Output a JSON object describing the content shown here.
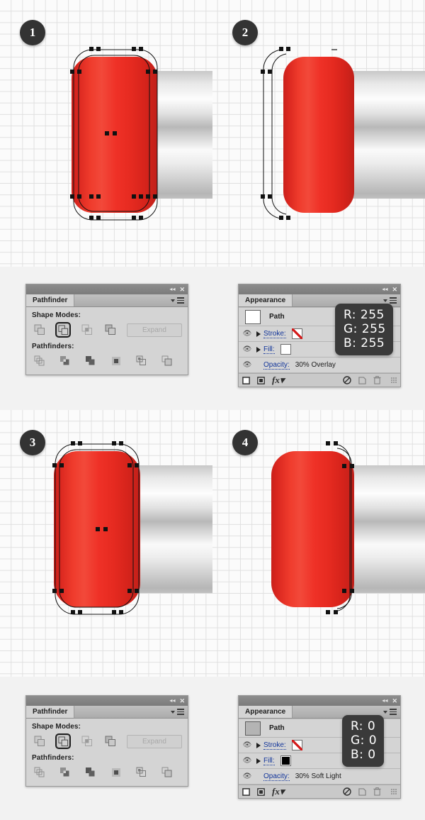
{
  "steps": [
    {
      "number": "1"
    },
    {
      "number": "2"
    },
    {
      "number": "3"
    },
    {
      "number": "4"
    }
  ],
  "pathfinder_panels": [
    {
      "tab_label": "Pathfinder",
      "shape_modes_label": "Shape Modes:",
      "pathfinders_label": "Pathfinders:",
      "expand_label": "Expand",
      "shape_mode_icons": [
        "unite-icon",
        "minus-front-icon",
        "intersect-icon",
        "exclude-icon"
      ],
      "selected_shape_mode_index": 1,
      "pathfinder_icons": [
        "divide-icon",
        "trim-icon",
        "merge-icon",
        "crop-icon",
        "outline-icon",
        "minus-back-icon"
      ],
      "titlebar_icons": [
        "collapse-icon",
        "close-icon"
      ],
      "menu_icon": "panel-menu-icon"
    },
    {
      "tab_label": "Pathfinder",
      "shape_modes_label": "Shape Modes:",
      "pathfinders_label": "Pathfinders:",
      "expand_label": "Expand",
      "shape_mode_icons": [
        "unite-icon",
        "minus-front-icon",
        "intersect-icon",
        "exclude-icon"
      ],
      "selected_shape_mode_index": 1,
      "pathfinder_icons": [
        "divide-icon",
        "trim-icon",
        "merge-icon",
        "crop-icon",
        "outline-icon",
        "minus-back-icon"
      ],
      "titlebar_icons": [
        "collapse-icon",
        "close-icon"
      ],
      "menu_icon": "panel-menu-icon"
    }
  ],
  "appearance_panels": [
    {
      "tab_label": "Appearance",
      "path_label": "Path",
      "thumb_color": "#ffffff",
      "rows": [
        {
          "key": "Stroke:",
          "swatch": "none",
          "eye": "visible"
        },
        {
          "key": "Fill:",
          "swatch": "white",
          "eye": "visible"
        }
      ],
      "opacity_key": "Opacity:",
      "opacity_value": "30% Overlay",
      "tooltip": {
        "r": "R: 255",
        "g": "G: 255",
        "b": "B: 255"
      },
      "footer_icons": [
        "add-new-stroke-icon",
        "add-new-fill-icon",
        "fx-icon",
        "clear-appearance-icon",
        "duplicate-item-icon",
        "delete-item-icon",
        "resize-grip-icon"
      ],
      "titlebar_icons": [
        "collapse-icon",
        "close-icon"
      ],
      "menu_icon": "panel-menu-icon"
    },
    {
      "tab_label": "Appearance",
      "path_label": "Path",
      "thumb_color": "#b4b4b4",
      "rows": [
        {
          "key": "Stroke:",
          "swatch": "none",
          "eye": "visible"
        },
        {
          "key": "Fill:",
          "swatch": "black",
          "eye": "visible"
        }
      ],
      "opacity_key": "Opacity:",
      "opacity_value": "30% Soft Light",
      "tooltip": {
        "r": "R: 0",
        "g": "G: 0",
        "b": "B: 0"
      },
      "footer_icons": [
        "add-new-stroke-icon",
        "add-new-fill-icon",
        "fx-icon",
        "clear-appearance-icon",
        "duplicate-item-icon",
        "delete-item-icon",
        "resize-grip-icon"
      ],
      "titlebar_icons": [
        "collapse-icon",
        "close-icon"
      ],
      "menu_icon": "panel-menu-icon"
    }
  ],
  "colors": {
    "canvas_bg": "#fbfbfb",
    "grid_line": "#e0e0e0",
    "band_bg": "#f2f2f2",
    "red_light": "#f2493a",
    "red_dark": "#c1201a",
    "badge_bg": "#333333",
    "panel_bg": "#d4d4d4",
    "link_blue": "#12359a",
    "tooltip_bg": "#3a3a3a"
  }
}
